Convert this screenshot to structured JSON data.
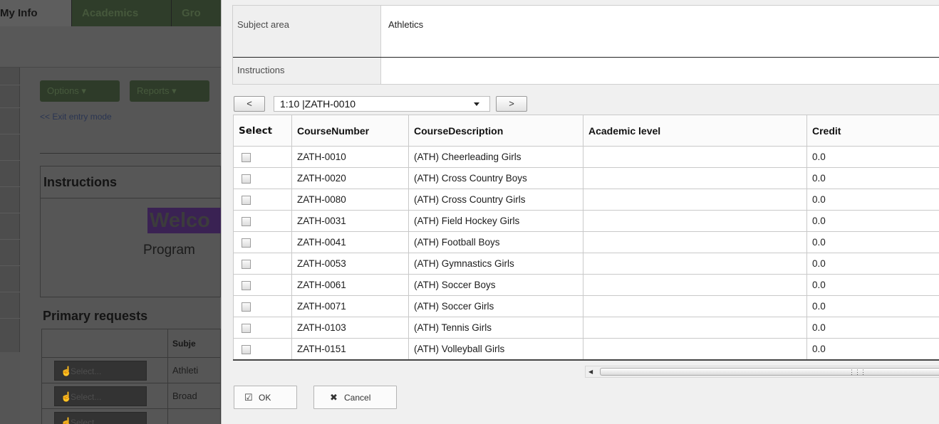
{
  "background": {
    "tabs": [
      {
        "label": "My Info"
      },
      {
        "label": "Academics"
      },
      {
        "label": "Gro"
      }
    ],
    "options_label": "Options ▾",
    "reports_label": "Reports ▾",
    "exit_link": "<< Exit entry mode",
    "instructions_title": "Instructions",
    "welcome_text": "Welco",
    "program_text": "Program",
    "primary_requests_title": "Primary requests",
    "primary_table": {
      "subject_header": "Subje",
      "rows": [
        {
          "button": "Select...",
          "subject": "Athleti"
        },
        {
          "button": "Select...",
          "subject": "Broad"
        },
        {
          "button": "Select...",
          "subject": ""
        }
      ]
    }
  },
  "dialog": {
    "subject_area": {
      "label": "Subject area",
      "value": "Athletics"
    },
    "instructions": {
      "label": "Instructions",
      "value": ""
    },
    "pager": {
      "prev_label": "<",
      "next_label": ">",
      "selected": "1:10 |ZATH-0010"
    },
    "columns": [
      "Select",
      "CourseNumber",
      "CourseDescription",
      "Academic level",
      "Credit"
    ],
    "rows": [
      {
        "number": "ZATH-0010",
        "description": "(ATH) Cheerleading Girls",
        "level": "",
        "credit": "0.0"
      },
      {
        "number": "ZATH-0020",
        "description": "(ATH) Cross Country Boys",
        "level": "",
        "credit": "0.0"
      },
      {
        "number": "ZATH-0080",
        "description": "(ATH) Cross Country Girls",
        "level": "",
        "credit": "0.0"
      },
      {
        "number": "ZATH-0031",
        "description": "(ATH) Field Hockey Girls",
        "level": "",
        "credit": "0.0"
      },
      {
        "number": "ZATH-0041",
        "description": "(ATH) Football Boys",
        "level": "",
        "credit": "0.0"
      },
      {
        "number": "ZATH-0053",
        "description": "(ATH) Gymnastics Girls",
        "level": "",
        "credit": "0.0"
      },
      {
        "number": "ZATH-0061",
        "description": "(ATH) Soccer Boys",
        "level": "",
        "credit": "0.0"
      },
      {
        "number": "ZATH-0071",
        "description": "(ATH) Soccer Girls",
        "level": "",
        "credit": "0.0"
      },
      {
        "number": "ZATH-0103",
        "description": "(ATH) Tennis Girls",
        "level": "",
        "credit": "0.0"
      },
      {
        "number": "ZATH-0151",
        "description": "(ATH) Volleyball Girls",
        "level": "",
        "credit": "0.0"
      }
    ],
    "ok_label": "OK",
    "cancel_label": "Cancel",
    "icons": {
      "ok": "check-square-icon",
      "cancel": "close-icon",
      "select": "hand-pointer-icon"
    }
  }
}
